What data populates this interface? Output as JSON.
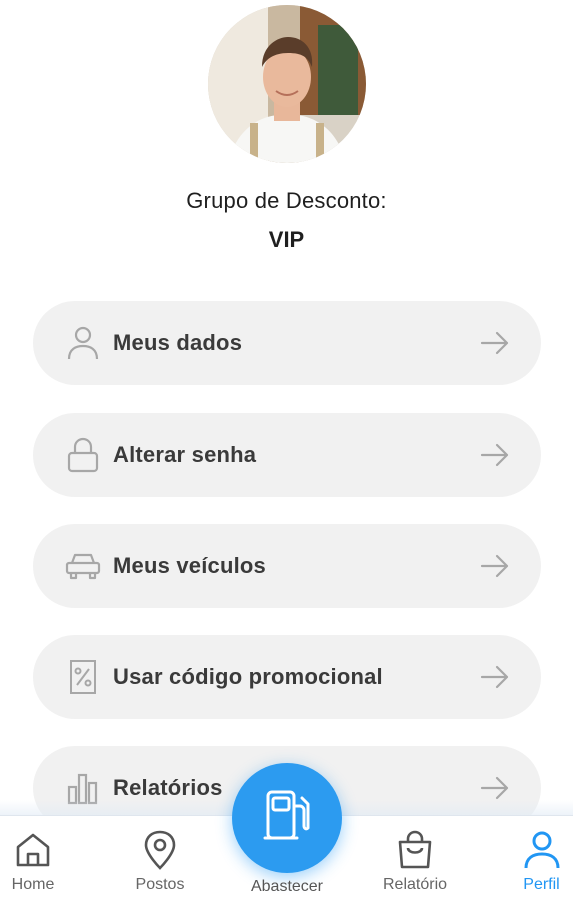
{
  "profile": {
    "group_label": "Grupo de Desconto:",
    "group_value": "VIP"
  },
  "menu": [
    {
      "label": "Meus dados",
      "icon": "user-icon"
    },
    {
      "label": "Alterar senha",
      "icon": "lock-icon"
    },
    {
      "label": "Meus veículos",
      "icon": "car-icon"
    },
    {
      "label": "Usar código promocional",
      "icon": "coupon-icon"
    },
    {
      "label": "Relatórios",
      "icon": "bar-chart-icon"
    }
  ],
  "bottom_nav": {
    "items": [
      {
        "label": "Home",
        "icon": "home-icon"
      },
      {
        "label": "Postos",
        "icon": "location-pin-icon"
      },
      {
        "label": "Abastecer",
        "icon": "fuel-pump-icon"
      },
      {
        "label": "Relatório",
        "icon": "shopping-bag-icon"
      },
      {
        "label": "Perfil",
        "icon": "profile-icon"
      }
    ],
    "active": "Perfil"
  },
  "colors": {
    "accent": "#2196f3",
    "card_bg": "#f1f1f1",
    "icon_gray": "#a7a7a7"
  }
}
